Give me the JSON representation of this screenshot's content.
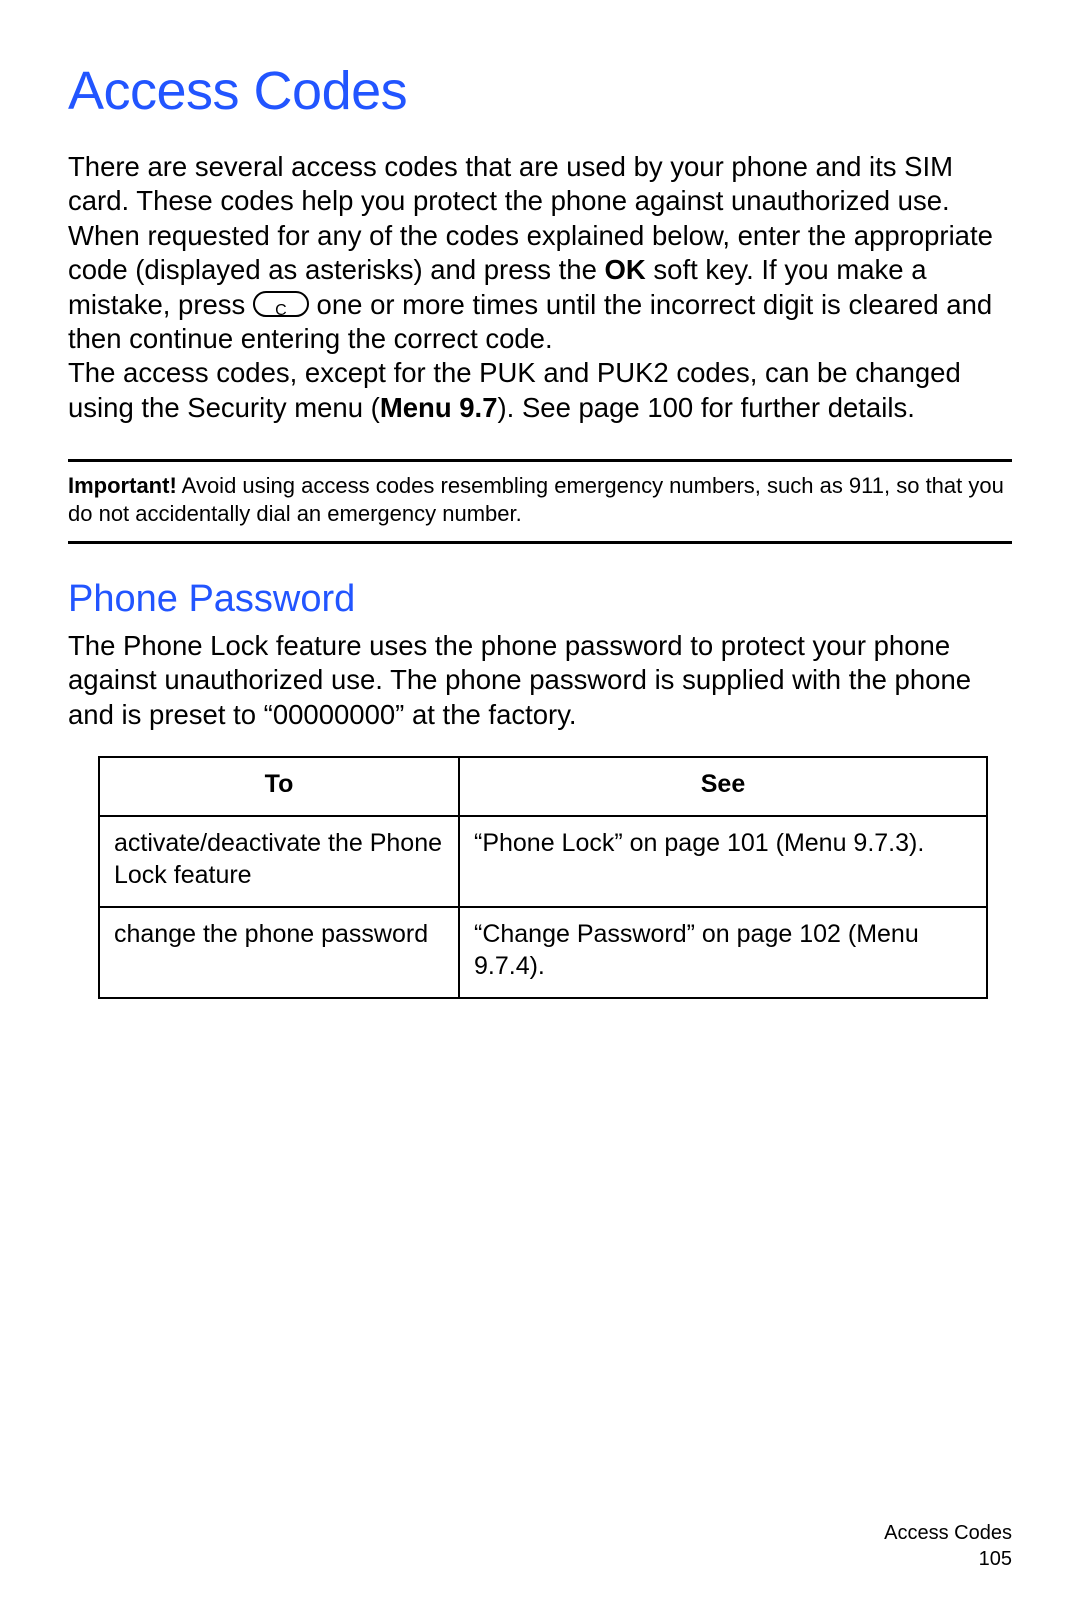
{
  "title": "Access Codes",
  "intro_p1": "There are several access codes that are used by your phone and its SIM card. These codes help you protect the phone against unauthorized use.",
  "intro_p2a": "When requested for any of the codes explained below, enter the appropriate code (displayed as asterisks) and press the ",
  "intro_ok": "OK",
  "intro_p2b": " soft key. If you make a mistake, press ",
  "intro_p2c": " one or more times until the incorrect digit is cleared and then continue entering the correct code.",
  "intro_p3a": "The access codes, except for the PUK and PUK2 codes, can be changed using the Security menu (",
  "intro_menu97": "Menu 9.7",
  "intro_p3b": "). See page 100 for further details.",
  "note_label": "Important!",
  "note_text": " Avoid using access codes resembling emergency numbers, such as 911, so that you do not accidentally dial an emergency number.",
  "section2_title": "Phone Password",
  "section2_body": "The Phone Lock feature uses the phone password to protect your phone against unauthorized use. The phone password is supplied with the phone and is preset to “00000000” at the factory.",
  "table": {
    "header": {
      "to": "To",
      "see": "See"
    },
    "rows": [
      {
        "to": "activate/deactivate the Phone Lock feature",
        "see_a": "“Phone Lock” on page 101 (",
        "see_bold": "Menu 9.7.3",
        "see_b": ")."
      },
      {
        "to": "change the phone password",
        "see_a": "“Change Password” on page 102 (",
        "see_bold": "Menu 9.7.4",
        "see_b": ")."
      }
    ]
  },
  "footer_section": "Access Codes",
  "footer_page": "105"
}
